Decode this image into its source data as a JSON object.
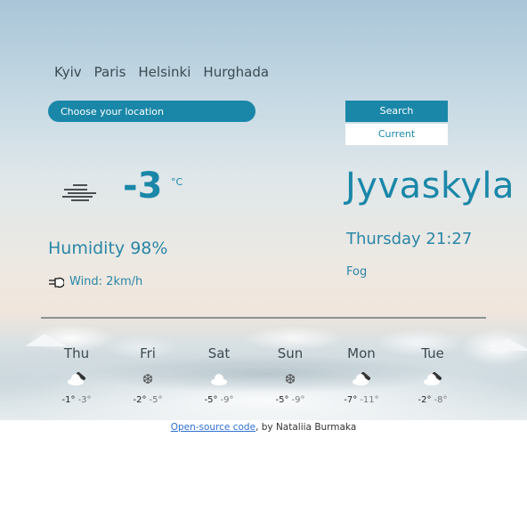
{
  "cities": [
    "Kyiv",
    "Paris",
    "Helsinki",
    "Hurghada"
  ],
  "search": {
    "placeholder": "Choose your location",
    "search_label": "Search",
    "current_label": "Current"
  },
  "current": {
    "icon": "fog-icon",
    "temperature": "-3",
    "unit": "°C",
    "humidity": "Humidity 98%",
    "wind": "Wind: 2km/h",
    "city": "Jyvaskyla",
    "datetime": "Thursday 21:27",
    "description": "Fog"
  },
  "forecast": [
    {
      "day": "Thu",
      "icon": "cloud-night-icon",
      "max": "-1°",
      "min": "-3°"
    },
    {
      "day": "Fri",
      "icon": "snowflake-icon",
      "max": "-2°",
      "min": "-5°"
    },
    {
      "day": "Sat",
      "icon": "cloud-icon",
      "max": "-5°",
      "min": "-9°"
    },
    {
      "day": "Sun",
      "icon": "snowflake-icon",
      "max": "-5°",
      "min": "-9°"
    },
    {
      "day": "Mon",
      "icon": "cloud-night-icon",
      "max": "-7°",
      "min": "-11°"
    },
    {
      "day": "Tue",
      "icon": "cloud-night-icon",
      "max": "-2°",
      "min": "-8°"
    }
  ],
  "footer": {
    "link_text": "Open-source code",
    "rest": ", by Nataliia Burmaka"
  }
}
